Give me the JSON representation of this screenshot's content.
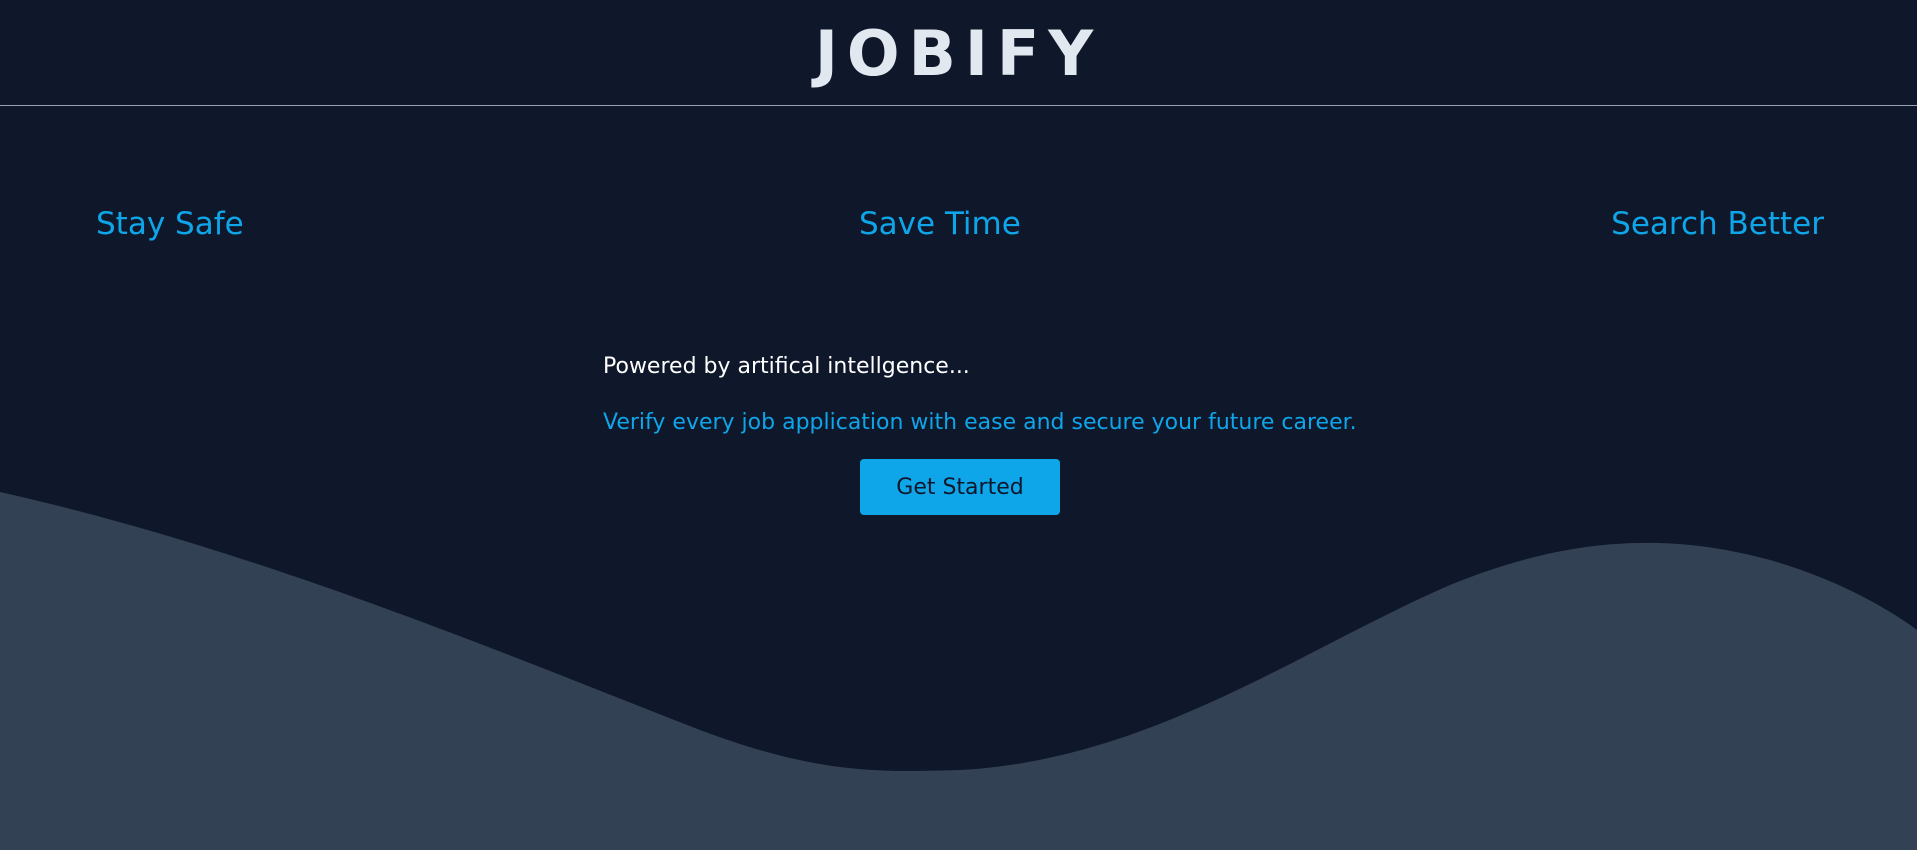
{
  "header": {
    "brand": "JOBIFY"
  },
  "features": {
    "left": "Stay Safe",
    "center": "Save Time",
    "right": "Search Better"
  },
  "hero": {
    "tagline": "Powered by artifical intellgence...",
    "subtext": "Verify every job application with ease and secure your future career.",
    "cta_label": "Get Started"
  },
  "colors": {
    "background": "#0f172a",
    "accent": "#0ea5e9",
    "wave": "#334155",
    "heading": "#e2e8f0"
  }
}
